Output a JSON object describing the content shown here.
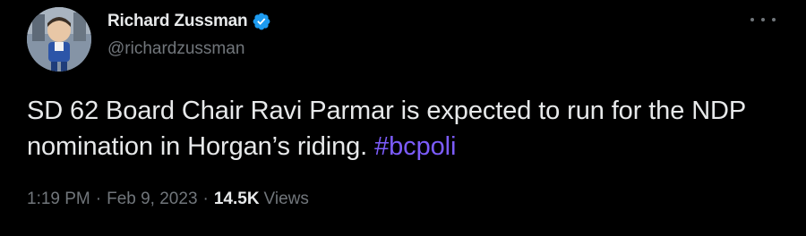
{
  "author": {
    "display_name": "Richard Zussman",
    "handle": "@richardzussman",
    "verified_icon": "verified-badge-icon",
    "avatar": "profile-avatar"
  },
  "tweet": {
    "text_main": "SD 62 Board Chair Ravi Parmar is expected to run for the NDP nomination in Horgan’s riding.",
    "hashtag": "#bcpoli"
  },
  "meta": {
    "time": "1:19 PM",
    "separator_1": "·",
    "date": "Feb 9, 2023",
    "separator_2": "·",
    "views_count": "14.5K",
    "views_label": "Views"
  },
  "icons": {
    "more": "more-options-icon"
  },
  "colors": {
    "background": "#000000",
    "text_primary": "#e7e9ea",
    "text_secondary": "#71767b",
    "hashtag": "#7c5cfc",
    "verified": "#1d9bf0"
  }
}
